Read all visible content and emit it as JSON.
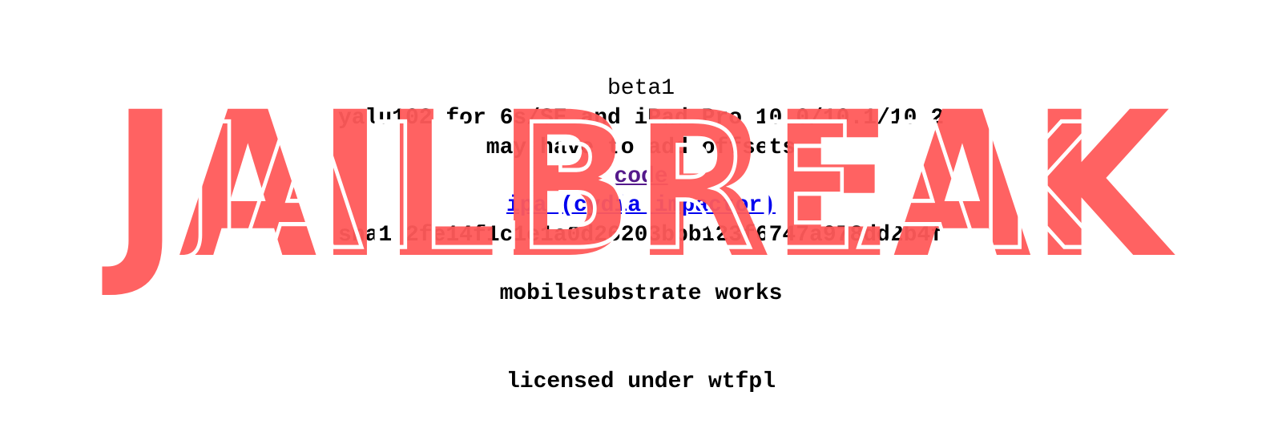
{
  "content": {
    "version": "beta1",
    "headline": "yalu102 for 6s/SE and iPad Pro 10.0/10.1/10.2",
    "note": "may have to add offsets",
    "code_link": "code",
    "ipa_link": "ipa (cydia impactor)",
    "sha1": "sha1 2fe14f1c1e1a0d26203bbb123f6747a978dd2b4f",
    "substrate_note": "mobilesubstrate works",
    "license": "licensed under wtfpl"
  },
  "overlay": {
    "text": "JAILBREAK",
    "color": "#ff5a5a",
    "inner_line_color": "#ffffff"
  },
  "colors": {
    "link": "#0000ee",
    "visited_link": "#551a8b",
    "text": "#000000",
    "background": "#ffffff"
  }
}
